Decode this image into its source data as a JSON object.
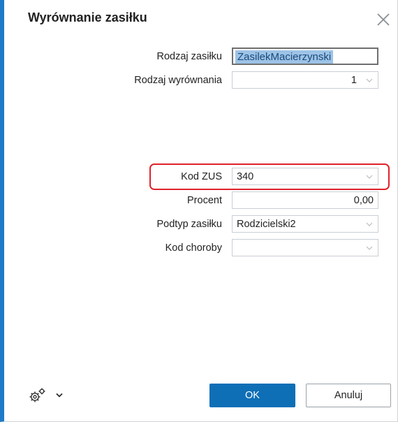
{
  "dialog": {
    "title": "Wyrównanie zasiłku",
    "close_icon": "close-icon"
  },
  "form": {
    "rodzaj_zasilku": {
      "label": "Rodzaj zasiłku",
      "value": "ZasilekMacierzynski"
    },
    "rodzaj_wyrownania": {
      "label": "Rodzaj wyrównania",
      "value": "1"
    },
    "kod_zus": {
      "label": "Kod ZUS",
      "value": "340"
    },
    "procent": {
      "label": "Procent",
      "value": "0,00"
    },
    "podtyp_zasilku": {
      "label": "Podtyp zasiłku",
      "value": "Rodzicielski2"
    },
    "kod_choroby": {
      "label": "Kod choroby",
      "value": ""
    }
  },
  "footer": {
    "settings_icon": "gear-icon",
    "ok_label": "OK",
    "cancel_label": "Anuluj"
  },
  "colors": {
    "accent": "#1f7ac8",
    "ok_button": "#0e6fb6",
    "highlight": "#e0222b",
    "selection": "#9dc3e6"
  }
}
